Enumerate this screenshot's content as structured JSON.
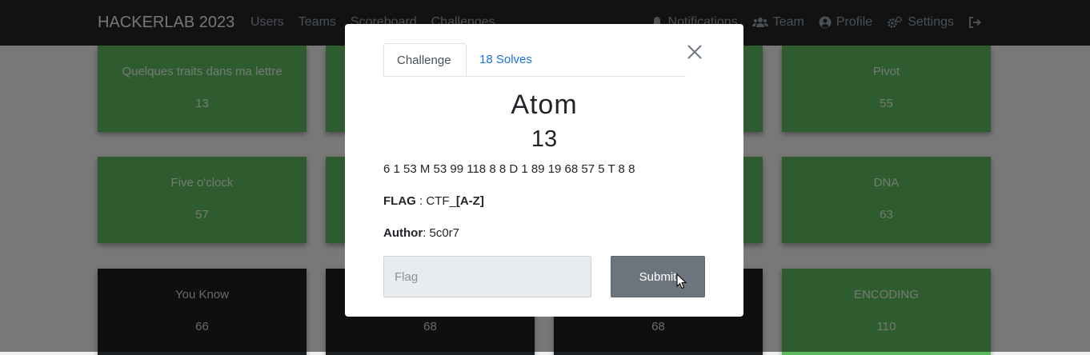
{
  "navbar": {
    "brand": "HACKERLAB 2023",
    "left_links": [
      "Users",
      "Teams",
      "Scoreboard",
      "Challenges"
    ],
    "right_links": [
      {
        "label": "Notifications",
        "icon": "bell-icon"
      },
      {
        "label": "Team",
        "icon": "users-icon"
      },
      {
        "label": "Profile",
        "icon": "user-circle-icon"
      },
      {
        "label": "Settings",
        "icon": "gears-icon"
      },
      {
        "label": "",
        "icon": "logout-icon"
      }
    ]
  },
  "challenges": [
    {
      "name": "Quelques traits dans ma lettre",
      "points": "13",
      "solved": true
    },
    {
      "name": "Pivot",
      "points": "55",
      "solved": true
    },
    {
      "name": "Five o'clock",
      "points": "57",
      "solved": true
    },
    {
      "name": "DNA",
      "points": "63",
      "solved": true
    },
    {
      "name": "You Know",
      "points": "66",
      "solved": false
    },
    {
      "name": "",
      "points": "68",
      "solved": false
    },
    {
      "name": "",
      "points": "68",
      "solved": false
    },
    {
      "name": "ENCODING",
      "points": "110",
      "solved": true
    }
  ],
  "modal": {
    "tabs": [
      {
        "label": "Challenge",
        "active": true
      },
      {
        "label": "18 Solves",
        "active": false
      }
    ],
    "title": "Atom",
    "value": "13",
    "description": "6 1 53 M 53 99 118 8 8 D 1 89 19 68 57 5 T 8 8",
    "flag_label": "FLAG",
    "flag_sep": " : ",
    "flag_value": "CTF_",
    "flag_pattern": "[A-Z]",
    "author_label": "Author",
    "author_sep": ": ",
    "author_value": "5c0r7",
    "input_placeholder": "Flag",
    "submit_label": "Submit"
  },
  "colors": {
    "navbar": "#212529",
    "solved": "#5cb85c",
    "unsolved": "#1c1f22",
    "link": "#1a73e8",
    "submit": "#6c757d"
  }
}
